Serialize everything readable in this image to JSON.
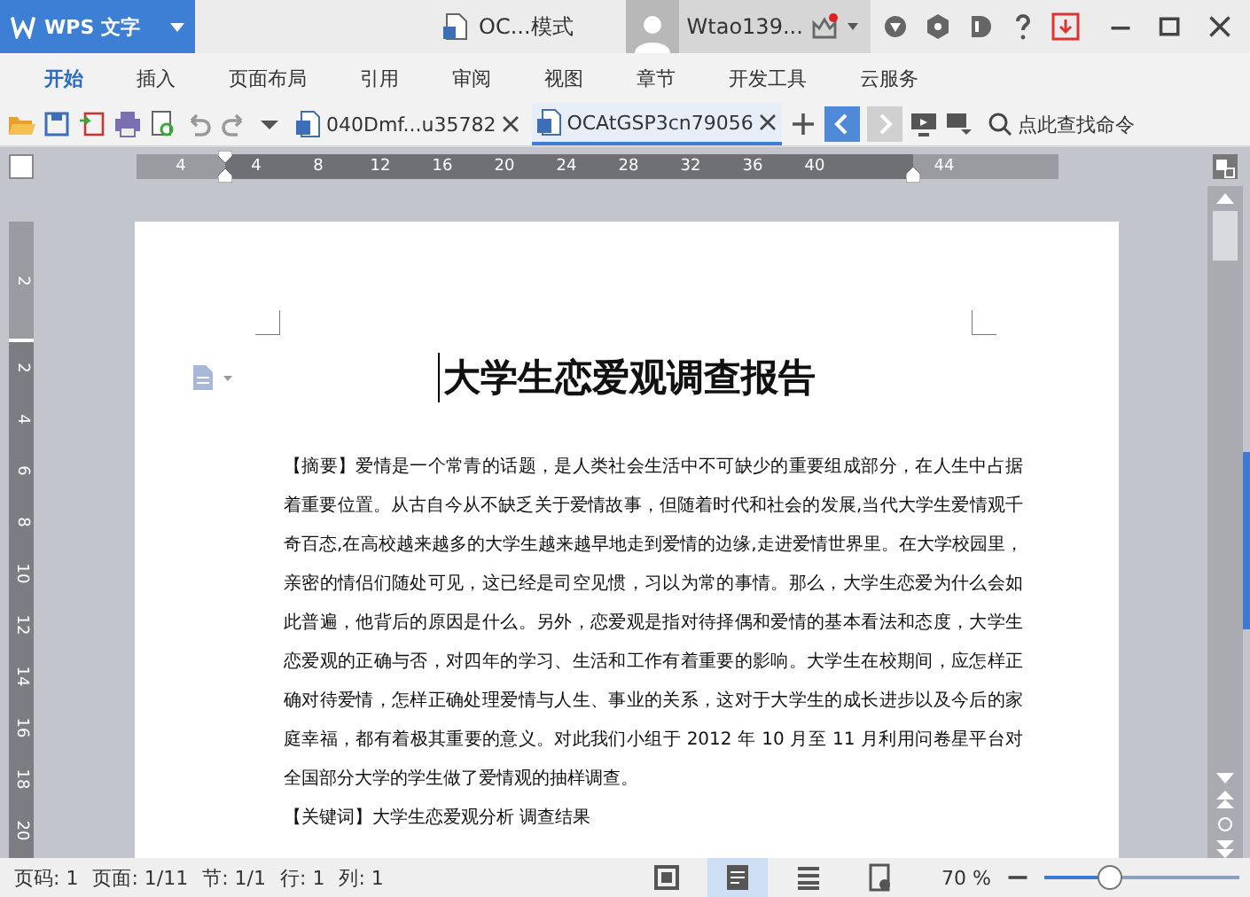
{
  "app_button": {
    "label": "WPS 文字"
  },
  "window": {
    "title": "OC...模式",
    "user": "Wtao139..."
  },
  "menu_tabs": [
    {
      "label": "开始",
      "selected": true
    },
    {
      "label": "插入",
      "selected": false
    },
    {
      "label": "页面布局",
      "selected": false
    },
    {
      "label": "引用",
      "selected": false
    },
    {
      "label": "审阅",
      "selected": false
    },
    {
      "label": "视图",
      "selected": false
    },
    {
      "label": "章节",
      "selected": false
    },
    {
      "label": "开发工具",
      "selected": false
    },
    {
      "label": "云服务",
      "selected": false
    }
  ],
  "doc_tabs": [
    {
      "label": "040Dmf...u35782",
      "selected": false
    },
    {
      "label": "OCAtGSP3cn79056",
      "selected": true
    }
  ],
  "search": {
    "placeholder": "点此查找命令"
  },
  "ruler": {
    "left_label": "4",
    "ticks": [
      "4",
      "8",
      "12",
      "16",
      "20",
      "24",
      "28",
      "32",
      "36",
      "40",
      "44"
    ]
  },
  "vertical_ruler": {
    "top_label": "2",
    "ticks": [
      "2",
      "4",
      "6",
      "8",
      "10",
      "12",
      "14",
      "16",
      "18",
      "20"
    ]
  },
  "document": {
    "title": "大学生恋爱观调查报告",
    "paragraphs": [
      "【摘要】爱情是一个常青的话题，是人类社会生活中不可缺少的重要组成部分，在人生中占据着重要位置。从古自今从不缺乏关于爱情故事，但随着时代和社会的发展,当代大学生爱情观千奇百态,在高校越来越多的大学生越来越早地走到爱情的边缘,走进爱情世界里。在大学校园里，亲密的情侣们随处可见，这已经是司空见惯，习以为常的事情。那么，大学生恋爱为什么会如此普遍，他背后的原因是什么。另外，恋爱观是指对待择偶和爱情的基本看法和态度，大学生恋爱观的正确与否，对四年的学习、生活和工作有着重要的影响。大学生在校期间，应怎样正确对待爱情，怎样正确处理爱情与人生、事业的关系，这对于大学生的成长进步以及今后的家庭幸福，都有着极其重要的意义。对此我们小组于 2012 年 10 月至 11 月利用问卷星平台对全国部分大学的学生做了爱情观的抽样调查。",
      "【关键词】大学生恋爱观分析 调查结果"
    ]
  },
  "status_bar": {
    "items": [
      "页码: 1",
      "页面: 1/11",
      "节: 1/1",
      "行: 1",
      "列: 1"
    ],
    "views": [
      {
        "kind": "fullscreen",
        "selected": false
      },
      {
        "kind": "page",
        "selected": true
      },
      {
        "kind": "outline",
        "selected": false
      },
      {
        "kind": "web",
        "selected": false
      }
    ],
    "zoom": "70 %"
  }
}
